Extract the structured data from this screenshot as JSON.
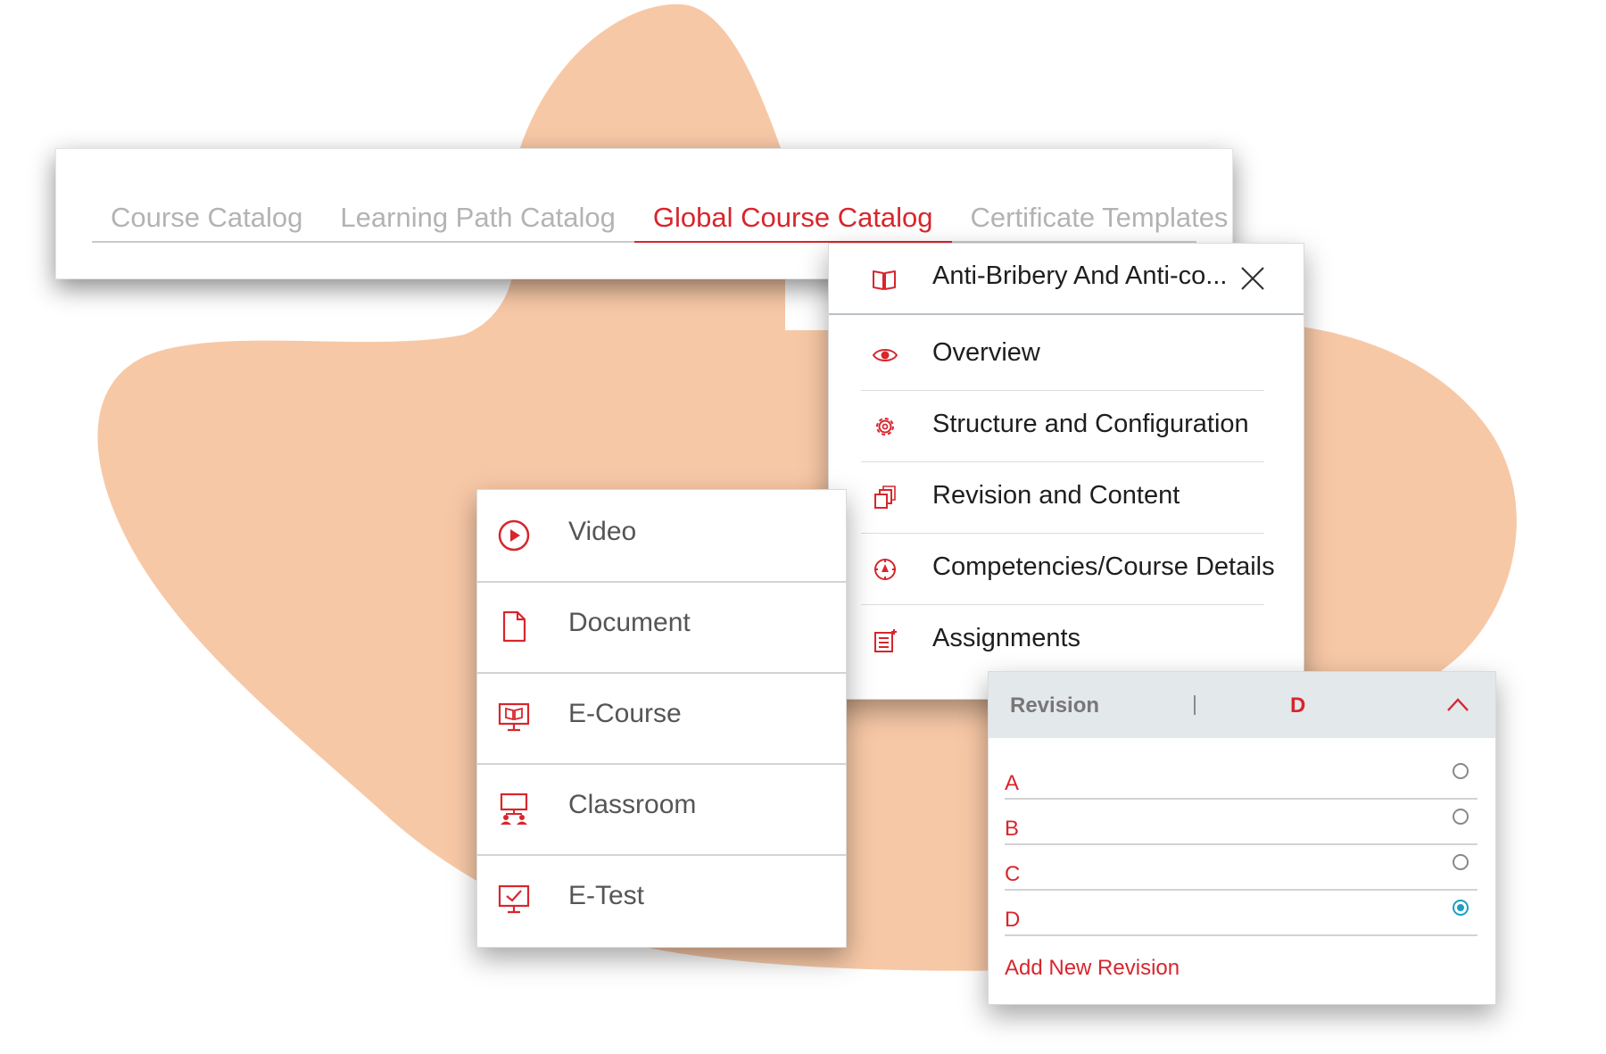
{
  "tabs": [
    {
      "label": "Course Catalog"
    },
    {
      "label": "Learning Path Catalog"
    },
    {
      "label": "Global Course Catalog",
      "active": true
    },
    {
      "label": "Certificate Templates"
    }
  ],
  "course_menu": {
    "title": "Anti-Bribery And Anti-co...",
    "title_icon": "book-icon",
    "close_icon": "close-icon",
    "items": [
      {
        "label": "Overview",
        "icon": "eye-icon"
      },
      {
        "label": "Structure and Configuration",
        "icon": "gear-icon"
      },
      {
        "label": "Revision and Content",
        "icon": "copy-icon"
      },
      {
        "label": "Competencies/Course Details",
        "icon": "compass-icon"
      },
      {
        "label": "Assignments",
        "icon": "assignment-icon"
      }
    ]
  },
  "content_types": [
    {
      "label": "Video",
      "icon": "play-icon"
    },
    {
      "label": "Document",
      "icon": "document-icon"
    },
    {
      "label": "E-Course",
      "icon": "monitor-book-icon"
    },
    {
      "label": "Classroom",
      "icon": "classroom-icon"
    },
    {
      "label": "E-Test",
      "icon": "monitor-check-icon"
    }
  ],
  "revision": {
    "label": "Revision",
    "selected": "D",
    "options": [
      "A",
      "B",
      "C",
      "D"
    ],
    "add_label": "Add New Revision"
  },
  "colors": {
    "accent": "#d7262d",
    "background_blob": "#f7c8a6",
    "radio_selected": "#1aa0c4",
    "revision_header_bg": "#e3e8eb"
  }
}
